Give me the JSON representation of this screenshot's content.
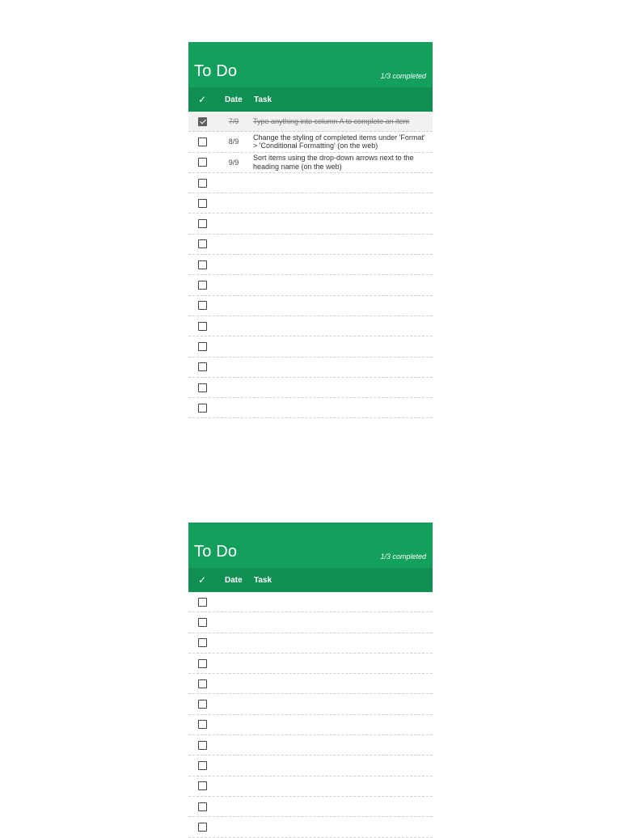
{
  "sheets": [
    {
      "title": "To Do",
      "progress": "1/3 completed",
      "columns": {
        "check": "✓",
        "date": "Date",
        "task": "Task"
      },
      "rows": [
        {
          "checked": true,
          "date": "7/9",
          "task": "Type anything into column A to complete an item"
        },
        {
          "checked": false,
          "date": "8/9",
          "task": "Change the styling of completed items under 'Format' > 'Conditional Formatting' (on the web)"
        },
        {
          "checked": false,
          "date": "9/9",
          "task": "Sort items using the drop-down arrows next to the heading name (on the web)"
        },
        {
          "checked": false,
          "date": "",
          "task": ""
        },
        {
          "checked": false,
          "date": "",
          "task": ""
        },
        {
          "checked": false,
          "date": "",
          "task": ""
        },
        {
          "checked": false,
          "date": "",
          "task": ""
        },
        {
          "checked": false,
          "date": "",
          "task": ""
        },
        {
          "checked": false,
          "date": "",
          "task": ""
        },
        {
          "checked": false,
          "date": "",
          "task": ""
        },
        {
          "checked": false,
          "date": "",
          "task": ""
        },
        {
          "checked": false,
          "date": "",
          "task": ""
        },
        {
          "checked": false,
          "date": "",
          "task": ""
        },
        {
          "checked": false,
          "date": "",
          "task": ""
        },
        {
          "checked": false,
          "date": "",
          "task": ""
        }
      ]
    },
    {
      "title": "To Do",
      "progress": "1/3 completed",
      "columns": {
        "check": "✓",
        "date": "Date",
        "task": "Task"
      },
      "rows": [
        {
          "checked": false,
          "date": "",
          "task": ""
        },
        {
          "checked": false,
          "date": "",
          "task": ""
        },
        {
          "checked": false,
          "date": "",
          "task": ""
        },
        {
          "checked": false,
          "date": "",
          "task": ""
        },
        {
          "checked": false,
          "date": "",
          "task": ""
        },
        {
          "checked": false,
          "date": "",
          "task": ""
        },
        {
          "checked": false,
          "date": "",
          "task": ""
        },
        {
          "checked": false,
          "date": "",
          "task": ""
        },
        {
          "checked": false,
          "date": "",
          "task": ""
        },
        {
          "checked": false,
          "date": "",
          "task": ""
        },
        {
          "checked": false,
          "date": "",
          "task": ""
        },
        {
          "checked": false,
          "date": "",
          "task": ""
        }
      ]
    }
  ],
  "colors": {
    "header": "#12a05c",
    "column_header": "#0f8f51",
    "completed_row": "#f1f1f1",
    "checkbox_checked": "#5f5f5f"
  }
}
